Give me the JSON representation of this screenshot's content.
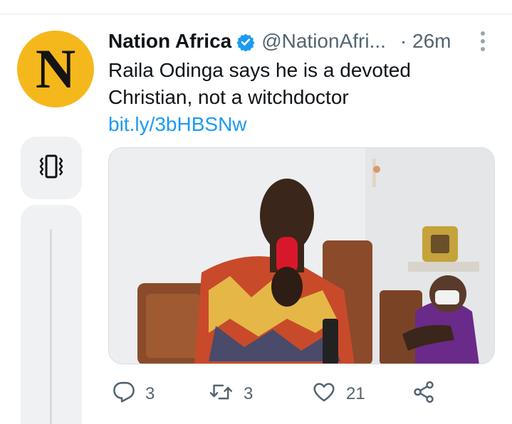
{
  "tweet": {
    "avatar_letter": "N",
    "author_name": "Nation Africa",
    "handle": "@NationAfri...",
    "time": "· 26m",
    "text_main": "Raila Odinga says he is a devoted Christian, not a witchdoctor ",
    "text_link": "bit.ly/3bHBSNw",
    "actions": {
      "replies": "3",
      "retweets": "3",
      "likes": "21"
    }
  },
  "colors": {
    "avatar_bg": "#f4b81c",
    "link": "#1d9bf0",
    "verified": "#1d9bf0",
    "muted": "#536471"
  },
  "icons": {
    "vibrate": "vibrate-icon",
    "verified": "verified-badge-icon",
    "more": "more-vertical-icon",
    "reply": "reply-icon",
    "retweet": "retweet-icon",
    "like": "heart-icon",
    "share": "share-icon"
  }
}
